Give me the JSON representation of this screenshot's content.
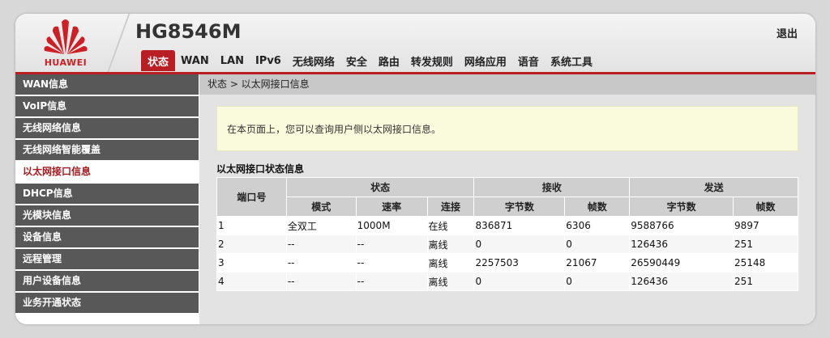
{
  "header": {
    "brand": "HUAWEI",
    "model": "HG8546M",
    "logout": "退出"
  },
  "nav": [
    "状态",
    "WAN",
    "LAN",
    "IPv6",
    "无线网络",
    "安全",
    "路由",
    "转发规则",
    "网络应用",
    "语音",
    "系统工具"
  ],
  "sidebar": [
    "WAN信息",
    "VoIP信息",
    "无线网络信息",
    "无线网络智能覆盖",
    "以太网接口信息",
    "DHCP信息",
    "光模块信息",
    "设备信息",
    "远程管理",
    "用户设备信息",
    "业务开通状态"
  ],
  "breadcrumb": "状态 > 以太网接口信息",
  "notice": "在本页面上，您可以查询用户侧以太网接口信息。",
  "section_title": "以太网接口状态信息",
  "table": {
    "port_header": "端口号",
    "group_status": "状态",
    "group_rx": "接收",
    "group_tx": "发送",
    "sub_headers": [
      "模式",
      "速率",
      "连接",
      "字节数",
      "帧数",
      "字节数",
      "帧数"
    ],
    "rows": [
      [
        "1",
        "全双工",
        "1000M",
        "在线",
        "836871",
        "6306",
        "9588766",
        "9897"
      ],
      [
        "2",
        "--",
        "--",
        "离线",
        "0",
        "0",
        "126436",
        "251"
      ],
      [
        "3",
        "--",
        "--",
        "离线",
        "2257503",
        "21067",
        "26590449",
        "25148"
      ],
      [
        "4",
        "--",
        "--",
        "离线",
        "0",
        "0",
        "126436",
        "251"
      ]
    ]
  },
  "colors": {
    "accent": "#b81e24",
    "sidebar_bg": "#585858",
    "notice_bg": "#fafadc"
  }
}
